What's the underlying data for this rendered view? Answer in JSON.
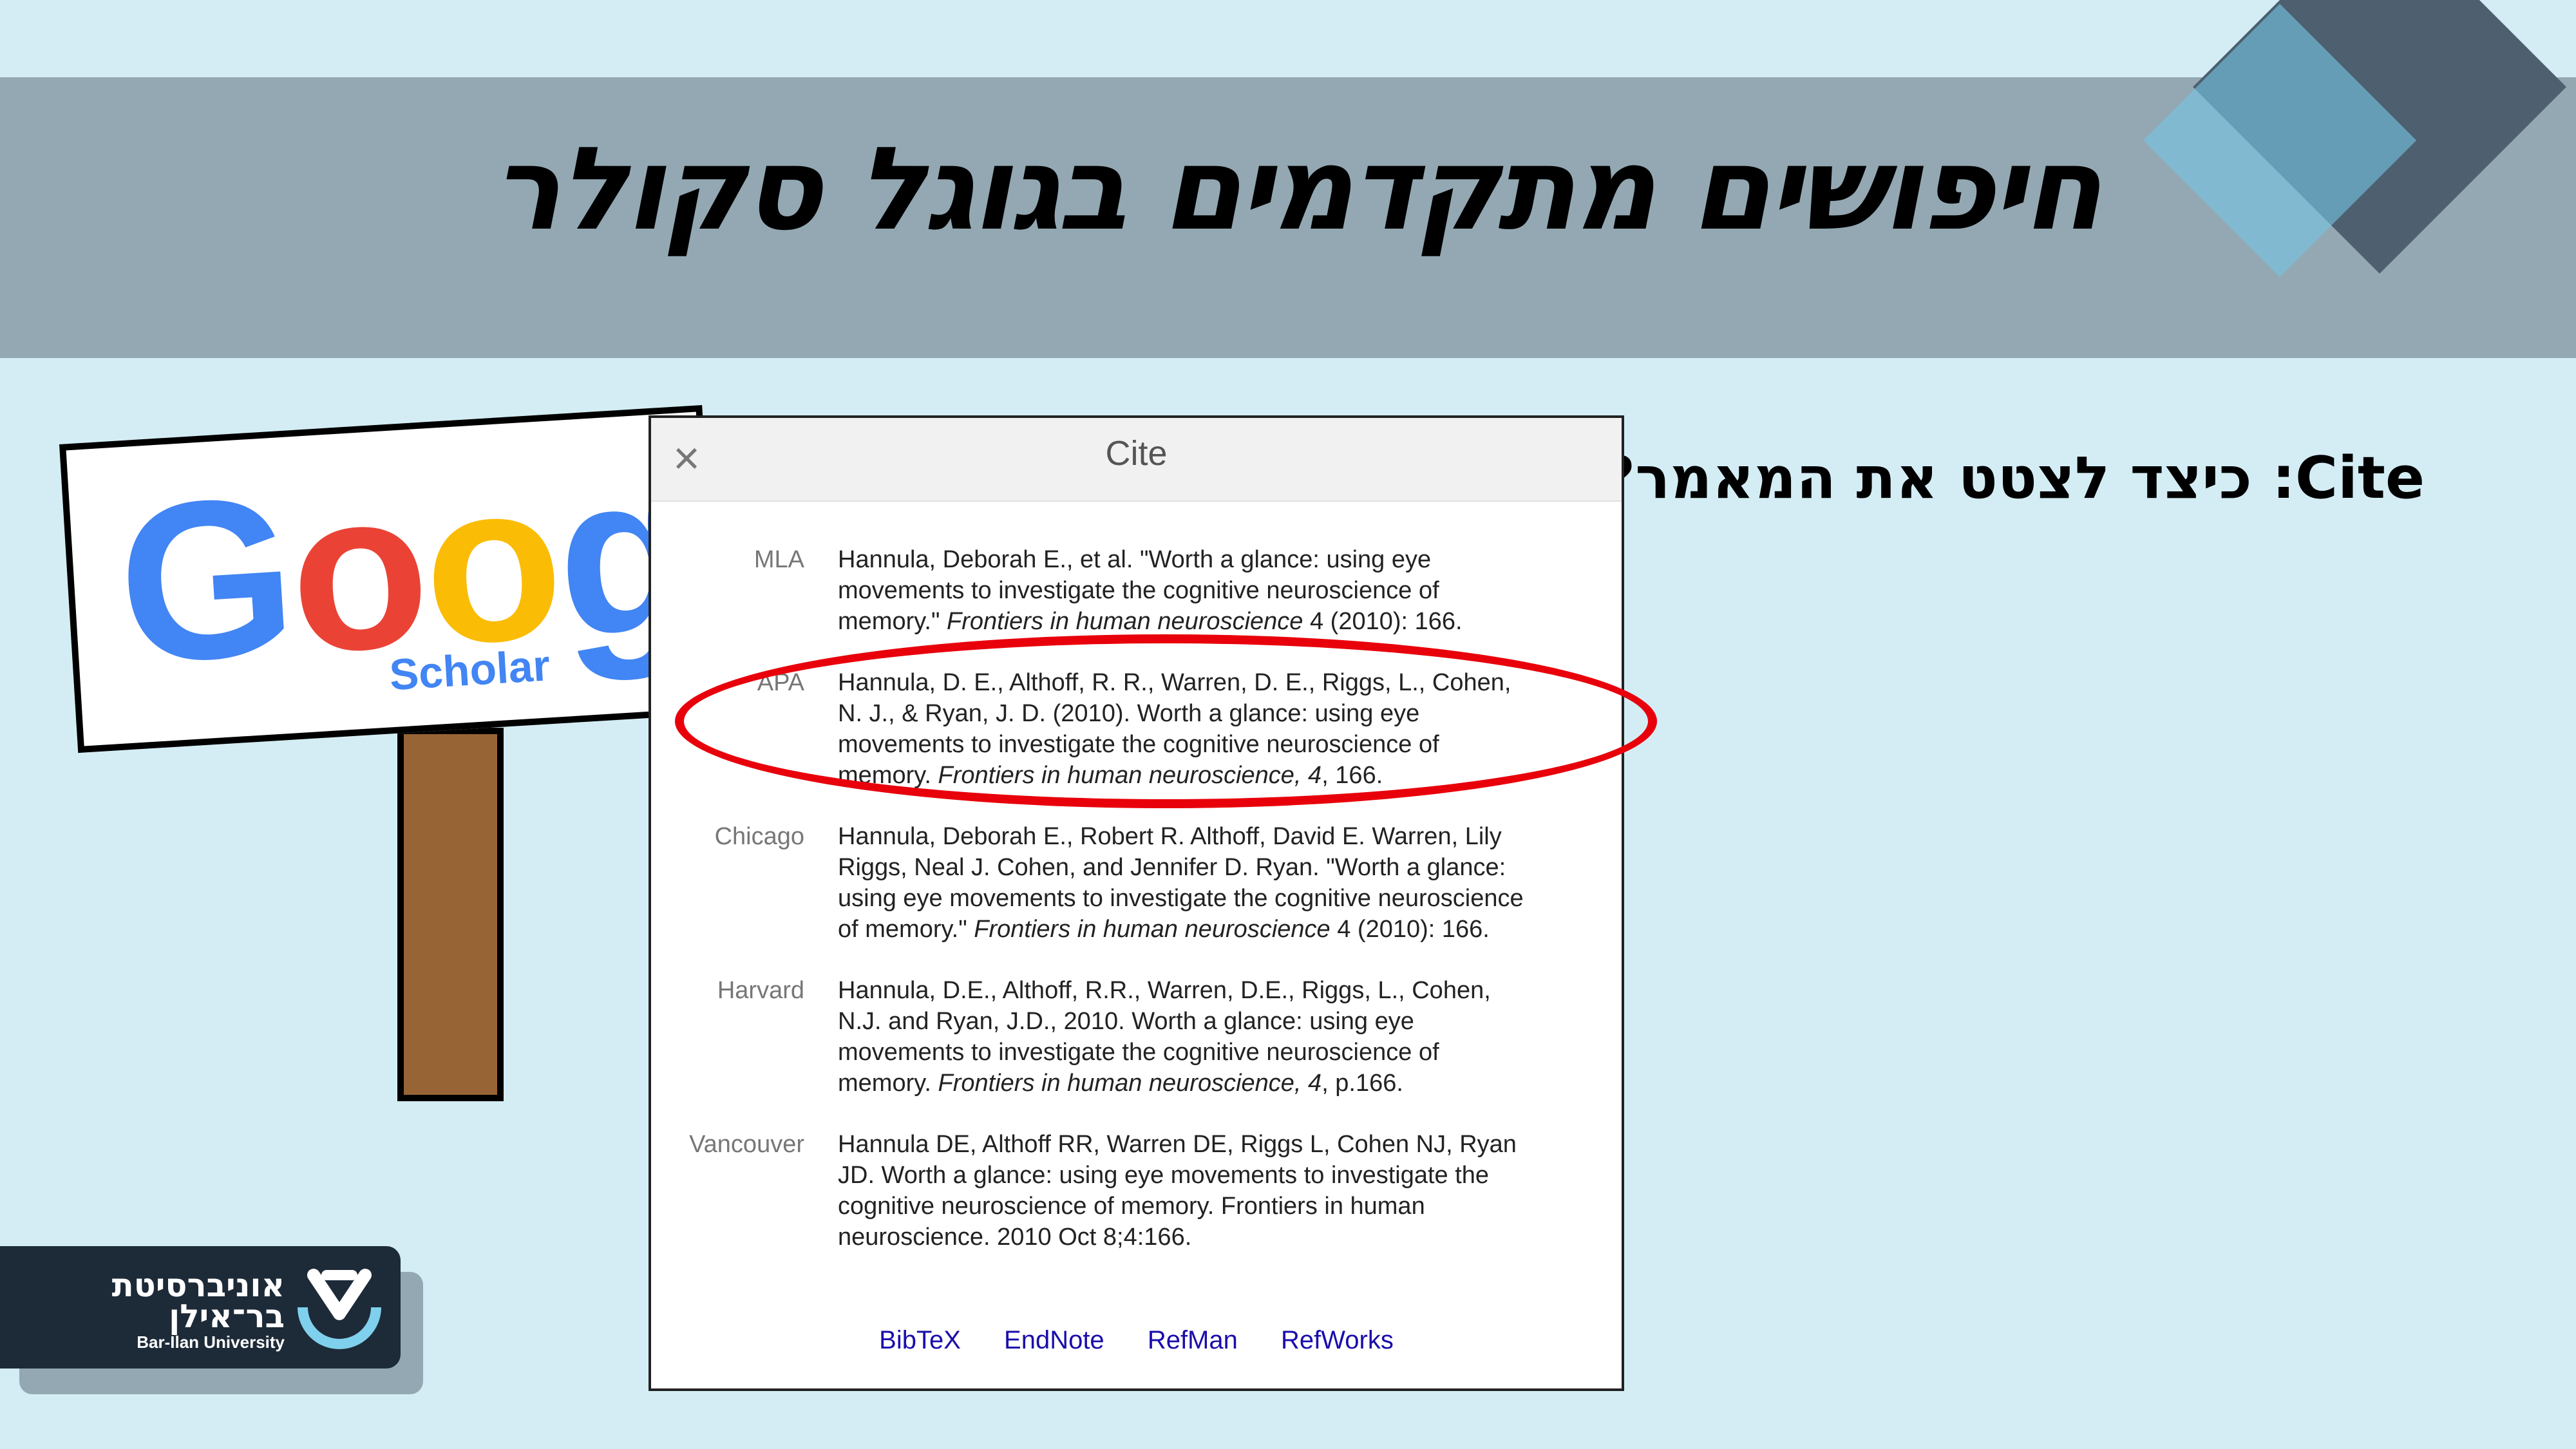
{
  "slide": {
    "title": "חיפושים מתקדמים בגוגל סקולר",
    "question": "Cite: כיצד לצטט את המאמר?"
  },
  "sign": {
    "logo_letters": [
      "G",
      "o",
      "o",
      "g"
    ],
    "logo_colors": [
      "#4285f4",
      "#ea4335",
      "#fbbc05",
      "#4285f4"
    ],
    "subtitle": "Scholar"
  },
  "dialog": {
    "close_icon": "close-icon",
    "title": "Cite",
    "citations": [
      {
        "style": "MLA",
        "text_before": "Hannula, Deborah E., et al. \"Worth a glance: using eye movements to investigate the cognitive neuroscience of memory.\" ",
        "journal": "Frontiers in human neuroscience",
        "text_after": " 4 (2010): 166."
      },
      {
        "style": "APA",
        "text_before": "Hannula, D. E., Althoff, R. R., Warren, D. E., Riggs, L., Cohen, N. J., & Ryan, J. D. (2010). Worth a glance: using eye movements to investigate the cognitive neuroscience of memory. ",
        "journal": "Frontiers in human neuroscience, 4",
        "text_after": ", 166."
      },
      {
        "style": "Chicago",
        "text_before": "Hannula, Deborah E., Robert R. Althoff, David E. Warren, Lily Riggs, Neal J. Cohen, and Jennifer D. Ryan. \"Worth a glance: using eye movements to investigate the cognitive neuroscience of memory.\" ",
        "journal": "Frontiers in human neuroscience",
        "text_after": " 4 (2010): 166."
      },
      {
        "style": "Harvard",
        "text_before": "Hannula, D.E., Althoff, R.R., Warren, D.E., Riggs, L., Cohen, N.J. and Ryan, J.D., 2010. Worth a glance: using eye movements to investigate the cognitive neuroscience of memory. ",
        "journal": "Frontiers in human neuroscience, 4",
        "text_after": ", p.166."
      },
      {
        "style": "Vancouver",
        "text_before": "Hannula DE, Althoff RR, Warren DE, Riggs L, Cohen NJ, Ryan JD. Worth a glance: using eye movements to investigate the cognitive neuroscience of memory. Frontiers in human neuroscience. 2010 Oct 8;4:166.",
        "journal": "",
        "text_after": ""
      }
    ],
    "export_links": [
      "BibTeX",
      "EndNote",
      "RefMan",
      "RefWorks"
    ],
    "highlighted_style": "APA",
    "highlight_color": "#e8000b"
  },
  "university_logo": {
    "hebrew_line1": "אוניברסיטת",
    "hebrew_line2": "בר־אילן",
    "english": "Bar-Ilan University"
  },
  "colors": {
    "background": "#d4edf5",
    "banner": "#93a8b3",
    "diamond_dark": "#4e5f6f",
    "diamond_light": "#76c4e2",
    "sign_post": "#976535",
    "link": "#1a0dab"
  }
}
